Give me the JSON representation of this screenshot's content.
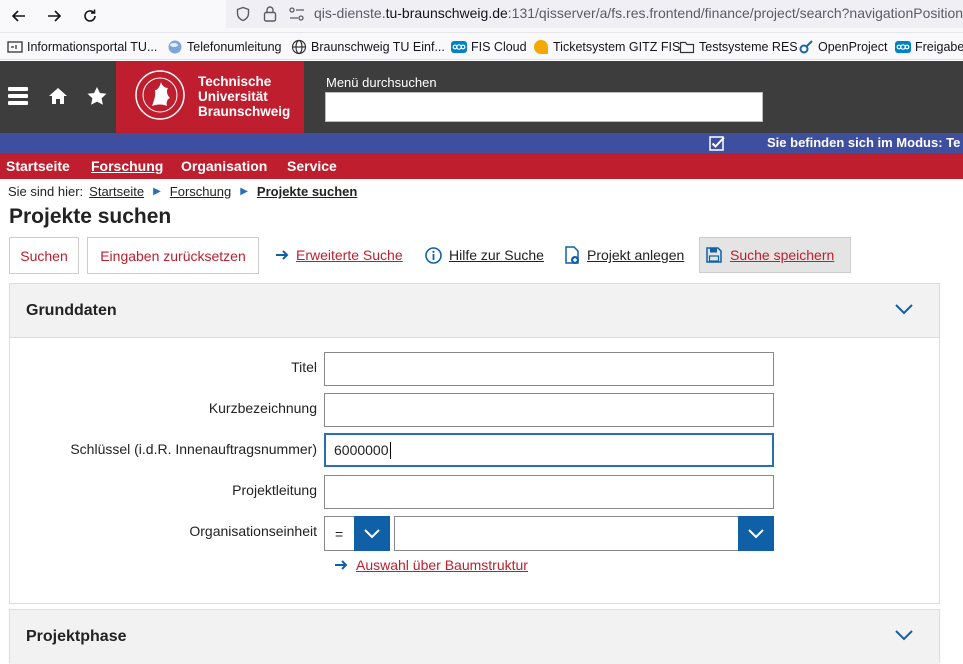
{
  "browser": {
    "url_prefix": "qis-dienste.",
    "url_domain": "tu-braunschweig.de",
    "url_rest": ":131/qisserver/a/fs.res.frontend/finance/project/search?navigationPosition=",
    "bookmarks": [
      {
        "label": "Informationsportal TU...",
        "icon": "portal-icon"
      },
      {
        "label": "Telefonumleitung",
        "icon": "globe-cloud-icon"
      },
      {
        "label": "Braunschweig TU Einf...",
        "icon": "globe-icon"
      },
      {
        "label": "FIS Cloud",
        "icon": "nextcloud-icon"
      },
      {
        "label": "Ticketsystem GITZ FIS",
        "icon": "ticket-icon"
      },
      {
        "label": "Testsysteme RES",
        "icon": "folder-icon"
      },
      {
        "label": "OpenProject",
        "icon": "openproject-icon"
      },
      {
        "label": "Freigaben",
        "icon": "nextcloud-icon"
      }
    ]
  },
  "header": {
    "logo_lines": [
      "Technische",
      "Universität",
      "Braunschweig"
    ],
    "menu_search_label": "Menü durchsuchen",
    "mode_text": "Sie befinden sich im Modus: Te"
  },
  "mainnav": [
    "Startseite",
    "Forschung",
    "Organisation",
    "Service"
  ],
  "breadcrumb": {
    "prefix": "Sie sind hier:",
    "items": [
      "Startseite",
      "Forschung"
    ],
    "current": "Projekte suchen"
  },
  "page_title": "Projekte suchen",
  "toolbar": {
    "search": "Suchen",
    "reset": "Eingaben zurücksetzen",
    "advanced": "Erweiterte Suche",
    "help": "Hilfe zur Suche",
    "create": "Projekt anlegen",
    "save": "Suche speichern"
  },
  "grunddaten": {
    "title": "Grunddaten",
    "fields": {
      "titel": {
        "label": "Titel",
        "value": ""
      },
      "kurz": {
        "label": "Kurzbezeichnung",
        "value": ""
      },
      "schluessel": {
        "label": "Schlüssel (i.d.R. Innenauftragsnummer)",
        "value": "6000000"
      },
      "leitung": {
        "label": "Projektleitung",
        "value": ""
      },
      "org": {
        "label": "Organisationseinheit",
        "operator": "=",
        "value": ""
      }
    },
    "tree_link": "Auswahl über Baumstruktur"
  },
  "projektphase": {
    "title": "Projektphase"
  },
  "colors": {
    "brand_red": "#be1e2d",
    "mode_blue": "#3f4f9f",
    "select_blue": "#1060a8",
    "header_dark": "#3d3d3d"
  }
}
